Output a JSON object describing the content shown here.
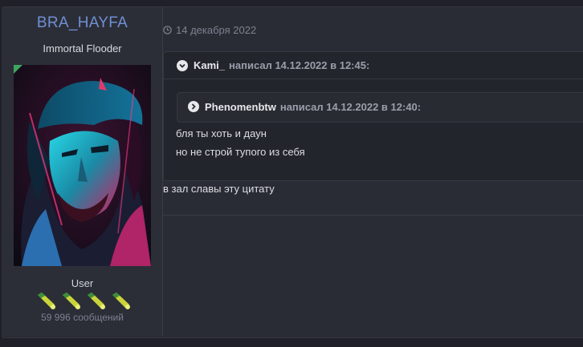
{
  "author": {
    "username": "BRA_HAYFA",
    "title": "Immortal Flooder",
    "group": "User",
    "posts_count": "59 996 сообщений",
    "online_color": "#3fa560",
    "username_color": "#6f8fd4",
    "rank_icons": [
      "rank-icon",
      "rank-icon",
      "rank-icon",
      "rank-icon"
    ]
  },
  "post": {
    "date": "14 декабря 2022",
    "quote": {
      "author": "Kami_",
      "header_suffix": "написал 14.12.2022 в 12:45:",
      "nested_quote": {
        "author": "Phenomenbtw",
        "header_suffix": "написал 14.12.2022 в 12:40:"
      },
      "lines": [
        "бля ты хоть и даун",
        "но не строй тупого из себя"
      ]
    },
    "body": "в зал славы эту цитату"
  }
}
